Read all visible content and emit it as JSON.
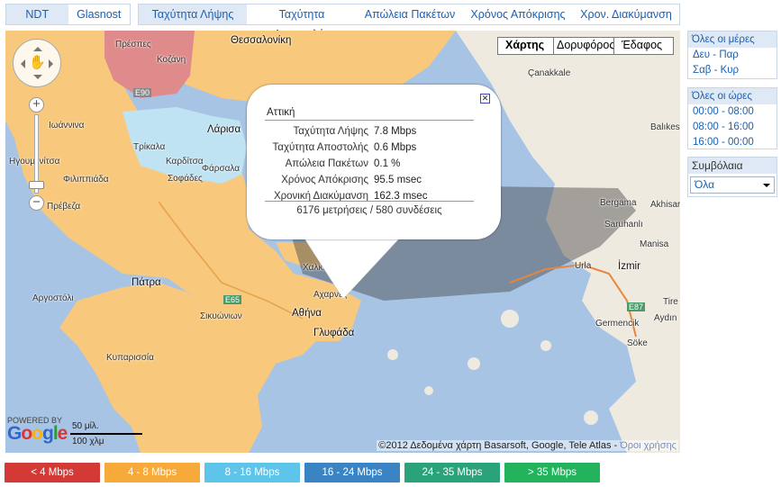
{
  "tabs_left": [
    {
      "label": "NDT",
      "active": true
    },
    {
      "label": "Glasnost",
      "active": false
    }
  ],
  "tabs_right": [
    {
      "label": "Ταχύτητα Λήψης",
      "active": true
    },
    {
      "label": "Ταχύτητα Αποστολής",
      "active": false
    },
    {
      "label": "Απώλεια Πακέτων",
      "active": false
    },
    {
      "label": "Χρόνος Απόκρισης",
      "active": false
    },
    {
      "label": "Χρον. Διακύμανση",
      "active": false
    }
  ],
  "map_type": {
    "map": "Χάρτης",
    "satellite": "Δορυφόρος",
    "terrain": "Έδαφος"
  },
  "map_labels": {
    "prespes": "Πρέσπες",
    "thessaloniki": "Θεσσαλονίκη",
    "kozani": "Κοζάνη",
    "ioannina": "Ιωάννινα",
    "larisa": "Λάρισα",
    "trikala": "Τρίκαλα",
    "karditsa": "Καρδίτσα",
    "farsala": "Φάρσαλα",
    "sofades": "Σοφάδες",
    "preveza": "Πρέβεζα",
    "filippiada": "Φιλιππιάδα",
    "igoumenitsa": "Ηγουμενίτσα",
    "evia": "Εύβοια",
    "chalkida": "Χαλκίδα",
    "patra": "Πάτρα",
    "athina": "Αθήνα",
    "glyfada": "Γλυφάδα",
    "acharnes": "Αχαρνές",
    "argostoli": "Αργοστόλι",
    "kyparissia": "Κυπαρισσία",
    "sikiona": "Σικυώνιων",
    "canakkale": "Çanakkale",
    "balikesir": "Balıkesir",
    "bergama": "Bergama",
    "akhisar": "Akhisar",
    "saruhanli": "Saruhanlı",
    "manisa": "Manisa",
    "izmir": "İzmir",
    "urla": "Urla",
    "tire": "Tire",
    "germencik": "Germencik",
    "aydin": "Aydın",
    "soke": "Söke",
    "e90": "E90",
    "e65": "E65",
    "e87": "E87"
  },
  "bubble": {
    "region": "Αττική",
    "rows": [
      {
        "label": "Ταχύτητα Λήψης",
        "value": "7.8 Mbps"
      },
      {
        "label": "Ταχύτητα Αποστολής",
        "value": "0.6 Mbps"
      },
      {
        "label": "Απώλεια Πακέτων",
        "value": "0.1 %"
      },
      {
        "label": "Χρόνος Απόκρισης",
        "value": "95.5 msec"
      },
      {
        "label": "Χρονική Διακύμανση",
        "value": "162.3 msec"
      }
    ],
    "summary": "6176 μετρήσεις / 580 συνδέσεις",
    "close": "✕"
  },
  "google": {
    "powered": "POWERED BY",
    "logo": "Google"
  },
  "scale": {
    "top": "50 μίλ.",
    "bottom": "100 χλμ"
  },
  "copyright": "©2012 Δεδομένα χάρτη Basarsoft, Google, Tele Atlas -",
  "terms": "Όροι χρήσης",
  "days_panel": {
    "header": "Όλες οι μέρες",
    "items": [
      "Δευ - Παρ",
      "Σαβ - Κυρ"
    ]
  },
  "hours_panel": {
    "header": "Όλες οι ώρες",
    "items": [
      "00:00 - 08:00",
      "08:00 - 16:00",
      "16:00 - 00:00"
    ]
  },
  "plans_panel": {
    "label": "Συμβόλαια",
    "selected": "Όλα"
  },
  "legend": [
    {
      "label": "< 4 Mbps",
      "color": "#d33a35"
    },
    {
      "label": "4 - 8 Mbps",
      "color": "#f7a93a"
    },
    {
      "label": "8 - 16 Mbps",
      "color": "#5fc4ea"
    },
    {
      "label": "16 - 24 Mbps",
      "color": "#3b84c4"
    },
    {
      "label": "24 - 35 Mbps",
      "color": "#2aa27a"
    },
    {
      "label": "> 35 Mbps",
      "color": "#22b35c"
    }
  ]
}
